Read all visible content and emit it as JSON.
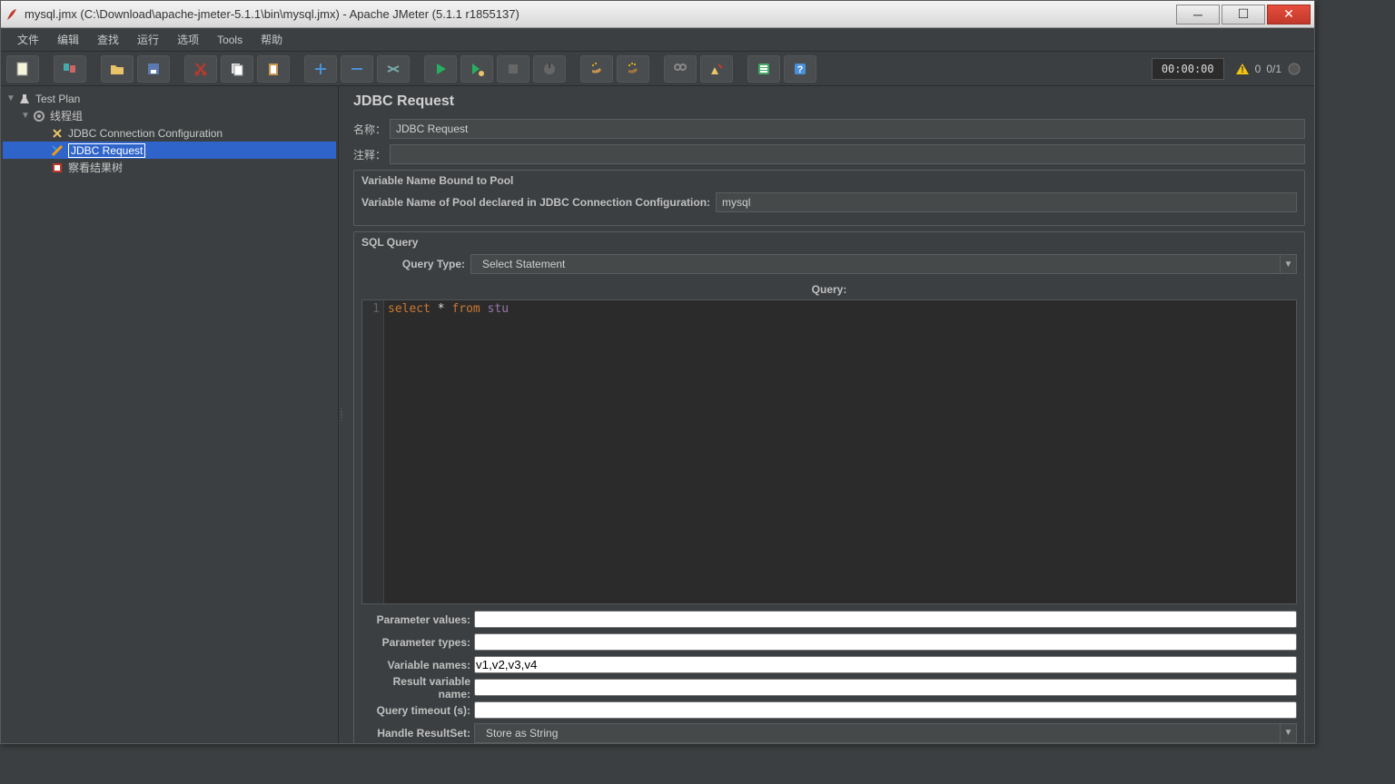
{
  "titlebar": {
    "text": "mysql.jmx (C:\\Download\\apache-jmeter-5.1.1\\bin\\mysql.jmx) - Apache JMeter (5.1.1 r1855137)"
  },
  "menu": {
    "file": "文件",
    "edit": "编辑",
    "search": "查找",
    "run": "运行",
    "options": "选项",
    "tools": "Tools",
    "help": "帮助"
  },
  "toolbar": {
    "timer": "00:00:00",
    "warn_count": "0",
    "thread_count": "0/1"
  },
  "tree": {
    "root": "Test Plan",
    "thread_group": "线程组",
    "jdbc_conn": "JDBC Connection Configuration",
    "jdbc_req": "JDBC Request",
    "results_tree": "察看结果树"
  },
  "editor": {
    "title": "JDBC Request",
    "name_label": "名称：",
    "name_value": "JDBC Request",
    "comment_label": "注释：",
    "comment_value": "",
    "var_group_title": "Variable Name Bound to Pool",
    "var_label": "Variable Name of Pool declared in JDBC Connection Configuration:",
    "var_value": "mysql",
    "sql_group_title": "SQL Query",
    "query_type_label": "Query Type:",
    "query_type_value": "Select Statement",
    "query_header": "Query:",
    "query_line_no": "1",
    "query_kw1": "select",
    "query_star": " * ",
    "query_kw2": "from",
    "query_table": " stu",
    "param_values_label": "Parameter values:",
    "param_values": "",
    "param_types_label": "Parameter types:",
    "param_types": "",
    "var_names_label": "Variable names:",
    "var_names": "v1,v2,v3,v4",
    "result_var_label": "Result variable name:",
    "result_var": "",
    "timeout_label": "Query timeout (s):",
    "timeout": "",
    "handle_label": "Handle ResultSet:",
    "handle_value": "Store as String"
  }
}
